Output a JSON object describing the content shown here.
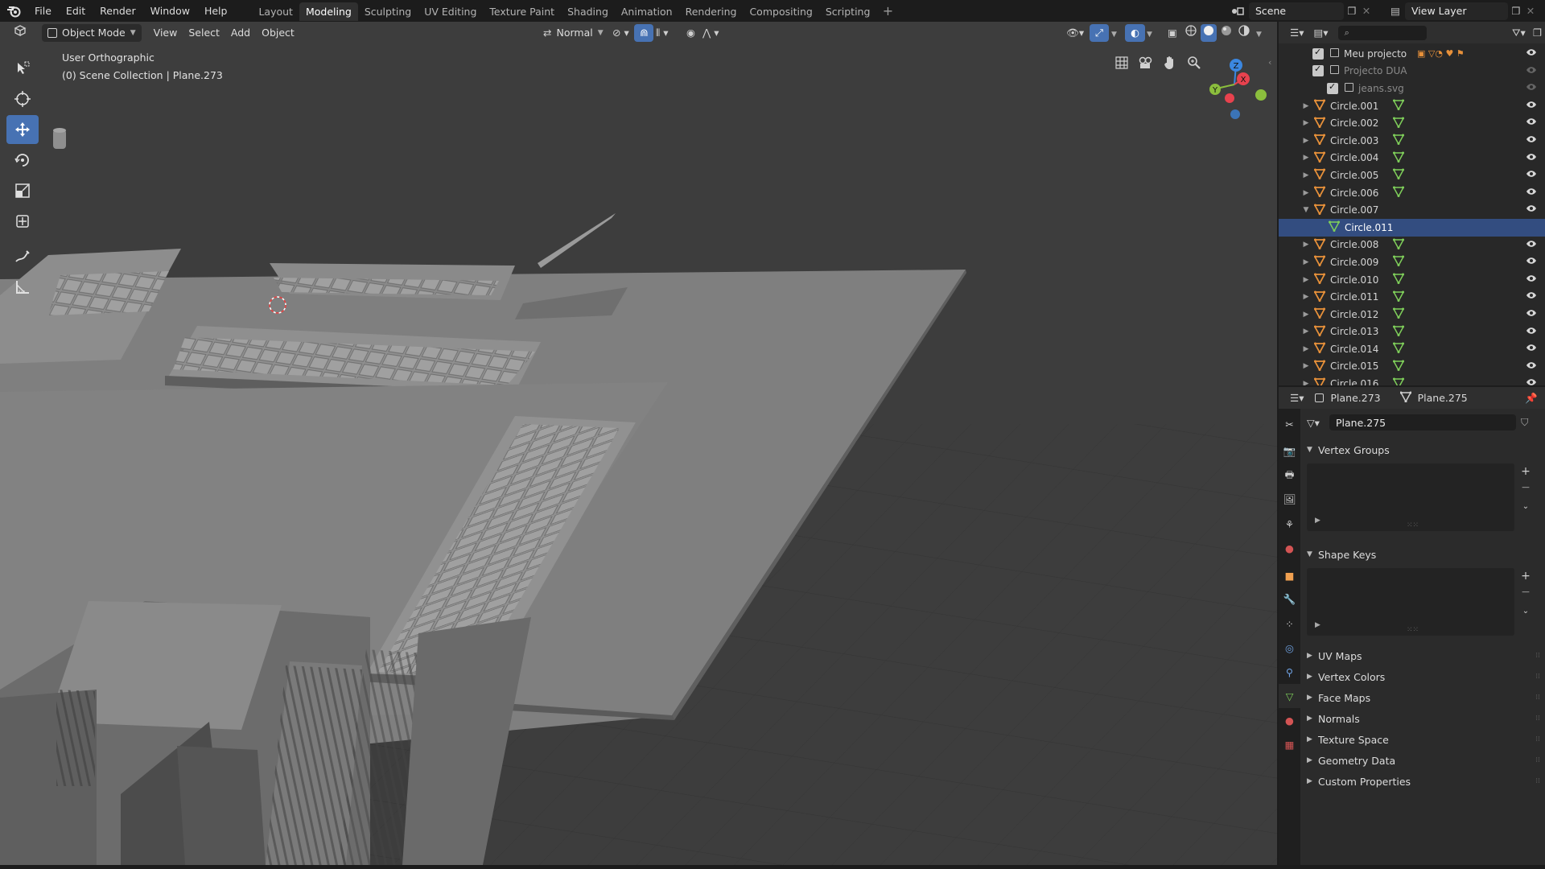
{
  "menubar": {
    "menus": [
      "File",
      "Edit",
      "Render",
      "Window",
      "Help"
    ],
    "workspaces": [
      "Layout",
      "Modeling",
      "Sculpting",
      "UV Editing",
      "Texture Paint",
      "Shading",
      "Animation",
      "Rendering",
      "Compositing",
      "Scripting"
    ],
    "active_workspace": "Modeling",
    "add_tab": "+",
    "scene_label": "Scene",
    "view_layer_label": "View Layer"
  },
  "viewport": {
    "mode": "Object Mode",
    "menus": [
      "View",
      "Select",
      "Add",
      "Object"
    ],
    "orientation": "Normal",
    "view_name": "User Orthographic",
    "collection_info": "(0) Scene Collection | Plane.273",
    "gizmo_axes": {
      "z": "Z",
      "x": "X",
      "y": "Y"
    },
    "colors": {
      "background": "#3d3d3d",
      "active_tool": "#4772b3",
      "axis_x": "#e8424e",
      "axis_y": "#8bbe3d",
      "axis_z": "#3b87e0"
    }
  },
  "outliner": {
    "search_placeholder": "",
    "rows": [
      {
        "name": "Meu projecto",
        "type": "collection"
      },
      {
        "name": "Projecto DUA",
        "type": "collection"
      },
      {
        "name": "jeans.svg",
        "type": "collection"
      },
      {
        "name": "Circle.001",
        "type": "object"
      },
      {
        "name": "Circle.002",
        "type": "object"
      },
      {
        "name": "Circle.003",
        "type": "object"
      },
      {
        "name": "Circle.004",
        "type": "object"
      },
      {
        "name": "Circle.005",
        "type": "object"
      },
      {
        "name": "Circle.006",
        "type": "object"
      },
      {
        "name": "Circle.007",
        "type": "object-expanded"
      },
      {
        "name": "Circle.011",
        "type": "mesh-data"
      },
      {
        "name": "Circle.008",
        "type": "object"
      },
      {
        "name": "Circle.009",
        "type": "object"
      },
      {
        "name": "Circle.010",
        "type": "object"
      },
      {
        "name": "Circle.011",
        "type": "object"
      },
      {
        "name": "Circle.012",
        "type": "object"
      },
      {
        "name": "Circle.013",
        "type": "object"
      },
      {
        "name": "Circle.014",
        "type": "object"
      },
      {
        "name": "Circle.015",
        "type": "object"
      },
      {
        "name": "Circle.016",
        "type": "object"
      }
    ],
    "colors": {
      "selected_row": "#334d80",
      "object_icon": "#e8913a",
      "mesh_icon": "#7fcf5a"
    }
  },
  "properties": {
    "object_name": "Plane.273",
    "data_name": "Plane.275",
    "datablock_field": "Plane.275",
    "panels": {
      "vertex_groups": "Vertex Groups",
      "shape_keys": "Shape Keys",
      "collapsed": [
        "UV Maps",
        "Vertex Colors",
        "Face Maps",
        "Normals",
        "Texture Space",
        "Geometry Data",
        "Custom Properties"
      ]
    }
  }
}
